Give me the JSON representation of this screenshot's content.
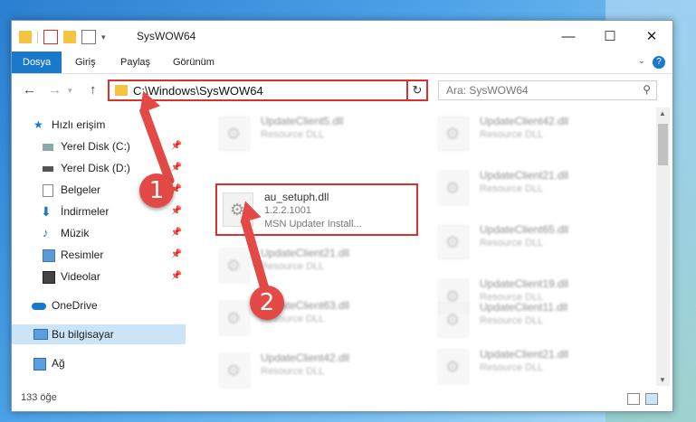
{
  "window": {
    "title": "SysWOW64",
    "minimize": "—",
    "maximize": "☐",
    "close": "✕"
  },
  "ribbon": {
    "tabs": [
      {
        "label": "Dosya",
        "active": true
      },
      {
        "label": "Giriş"
      },
      {
        "label": "Paylaş"
      },
      {
        "label": "Görünüm"
      }
    ],
    "help": "?"
  },
  "nav": {
    "back": "←",
    "forward": "→",
    "up": "↑",
    "address": "C:\\Windows\\SysWOW64",
    "refresh": "↻"
  },
  "search": {
    "placeholder": "Ara: SysWOW64"
  },
  "sidebar": {
    "items": [
      {
        "label": "Hızlı erişim",
        "icon": "star-icon"
      },
      {
        "label": "Yerel Disk (C:)",
        "icon": "drive-icon",
        "pinned": true
      },
      {
        "label": "Yerel Disk (D:)",
        "icon": "drive-icon",
        "pinned": true
      },
      {
        "label": "Belgeler",
        "icon": "documents-icon",
        "pinned": true
      },
      {
        "label": "İndirmeler",
        "icon": "download-icon",
        "pinned": true
      },
      {
        "label": "Müzik",
        "icon": "music-icon",
        "pinned": true
      },
      {
        "label": "Resimler",
        "icon": "pictures-icon",
        "pinned": true
      },
      {
        "label": "Videolar",
        "icon": "videos-icon",
        "pinned": true
      },
      {
        "label": "OneDrive",
        "icon": "cloud-icon"
      },
      {
        "label": "Bu bilgisayar",
        "icon": "computer-icon",
        "selected": true
      },
      {
        "label": "Ağ",
        "icon": "network-icon"
      }
    ],
    "pin_glyph": "📌"
  },
  "files": {
    "highlighted": {
      "name": "au_setuph.dll",
      "version": "1.2.2.1001",
      "description": "MSN Updater Install..."
    },
    "left_col": [
      {
        "name": "UpdateClient5.dll",
        "type": "Resource DLL"
      },
      {
        "name": "UpdateClient21.dll",
        "type": "Resource DLL"
      },
      {
        "name": "UpdateClient63.dll",
        "type": "Resource DLL"
      },
      {
        "name": "UpdateClient42.dll",
        "type": "Resource DLL"
      }
    ],
    "right_col": [
      {
        "name": "UpdateClient42.dll",
        "type": "Resource DLL"
      },
      {
        "name": "UpdateClient21.dll",
        "type": "Resource DLL"
      },
      {
        "name": "UpdateClient65.dll",
        "type": "Resource DLL"
      },
      {
        "name": "UpdateClient19.dll",
        "type": "Resource DLL"
      },
      {
        "name": "UpdateClient11.dll",
        "type": "Resource DLL"
      },
      {
        "name": "UpdateClient21.dll",
        "type": "Resource DLL"
      }
    ]
  },
  "status": {
    "count": "133 öğe"
  },
  "annotations": {
    "step1": "1",
    "step2": "2"
  },
  "colors": {
    "accent": "#1979ca",
    "highlight": "#d9322e",
    "annotation": "#e34a46"
  }
}
